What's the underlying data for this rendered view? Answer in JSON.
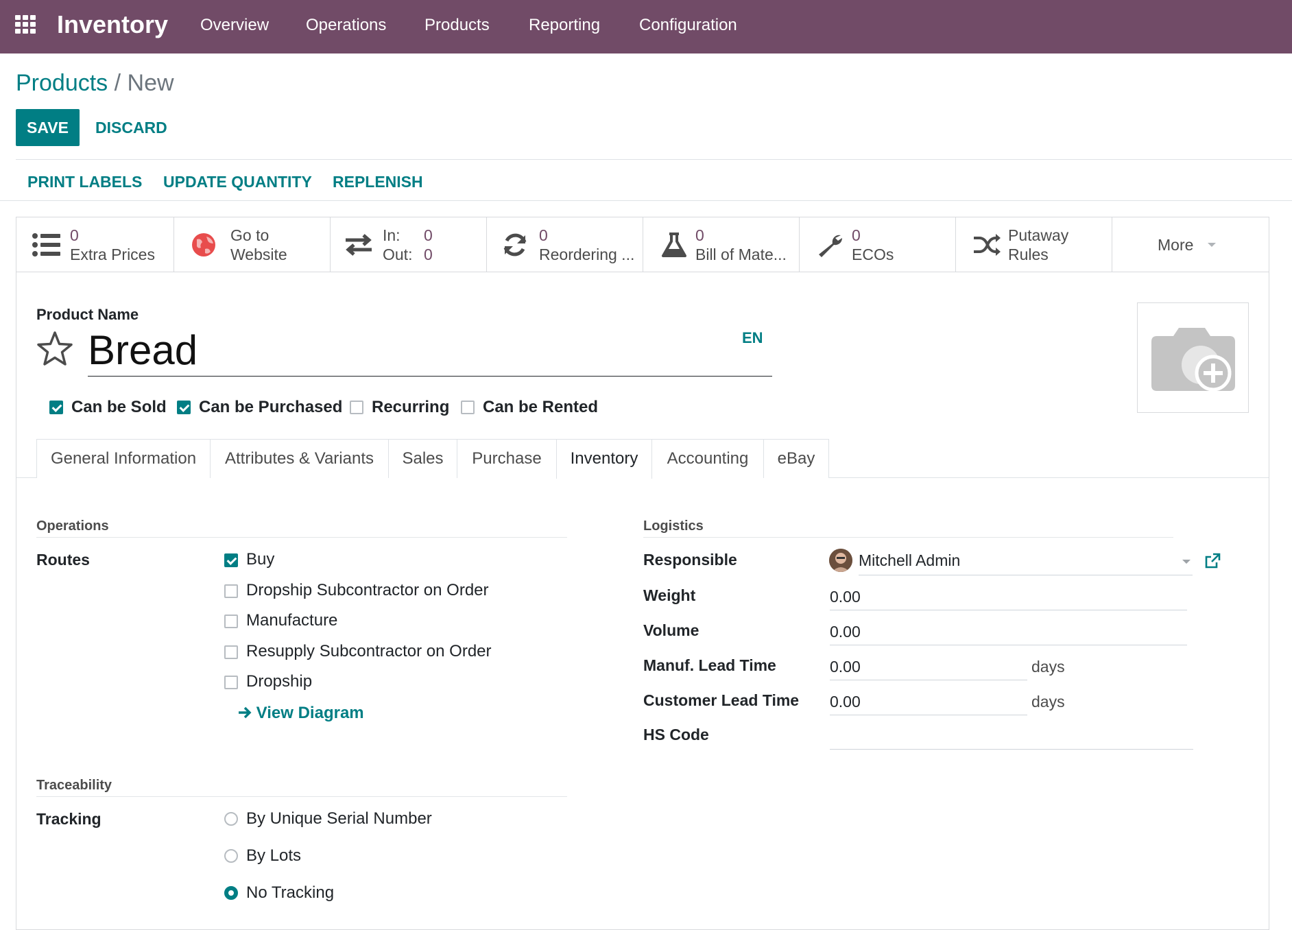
{
  "navbar": {
    "app_title": "Inventory",
    "menu": [
      "Overview",
      "Operations",
      "Products",
      "Reporting",
      "Configuration"
    ]
  },
  "breadcrumb": {
    "parent": "Products",
    "separator": "/",
    "current": "New"
  },
  "buttons": {
    "save": "SAVE",
    "discard": "DISCARD"
  },
  "actions": [
    "PRINT LABELS",
    "UPDATE QUANTITY",
    "REPLENISH"
  ],
  "stat_buttons": {
    "extra_prices": {
      "count": "0",
      "label": "Extra Prices"
    },
    "website": {
      "line1": "Go to",
      "line2": "Website"
    },
    "in_out": {
      "in_label": "In:",
      "in_value": "0",
      "out_label": "Out:",
      "out_value": "0"
    },
    "reordering": {
      "count": "0",
      "label": "Reordering ..."
    },
    "bom": {
      "count": "0",
      "label": "Bill of Mate..."
    },
    "ecos": {
      "count": "0",
      "label": "ECOs"
    },
    "putaway": {
      "line1": "Putaway",
      "line2": "Rules"
    },
    "more": "More"
  },
  "product": {
    "name_label": "Product Name",
    "name": "Bread",
    "lang": "EN",
    "flags": [
      {
        "label": "Can be Sold",
        "checked": true
      },
      {
        "label": "Can be Purchased",
        "checked": true
      },
      {
        "label": "Recurring",
        "checked": false
      },
      {
        "label": "Can be Rented",
        "checked": false
      }
    ]
  },
  "tabs": [
    "General Information",
    "Attributes & Variants",
    "Sales",
    "Purchase",
    "Inventory",
    "Accounting",
    "eBay"
  ],
  "active_tab": "Inventory",
  "operations": {
    "title": "Operations",
    "routes_label": "Routes",
    "routes": [
      {
        "label": "Buy",
        "checked": true
      },
      {
        "label": "Dropship Subcontractor on Order",
        "checked": false
      },
      {
        "label": "Manufacture",
        "checked": false
      },
      {
        "label": "Resupply Subcontractor on Order",
        "checked": false
      },
      {
        "label": "Dropship",
        "checked": false
      }
    ],
    "view_diagram": "View Diagram"
  },
  "traceability": {
    "title": "Traceability",
    "tracking_label": "Tracking",
    "options": [
      {
        "label": "By Unique Serial Number",
        "selected": false
      },
      {
        "label": "By Lots",
        "selected": false
      },
      {
        "label": "No Tracking",
        "selected": true
      }
    ]
  },
  "logistics": {
    "title": "Logistics",
    "responsible_label": "Responsible",
    "responsible": "Mitchell Admin",
    "weight_label": "Weight",
    "weight": "0.00",
    "volume_label": "Volume",
    "volume": "0.00",
    "manuf_label": "Manuf. Lead Time",
    "manuf": "0.00",
    "customer_label": "Customer Lead Time",
    "customer": "0.00",
    "days": "days",
    "hs_label": "HS Code",
    "hs": ""
  },
  "colors": {
    "brand": "#714b67",
    "primary": "#017e84"
  }
}
